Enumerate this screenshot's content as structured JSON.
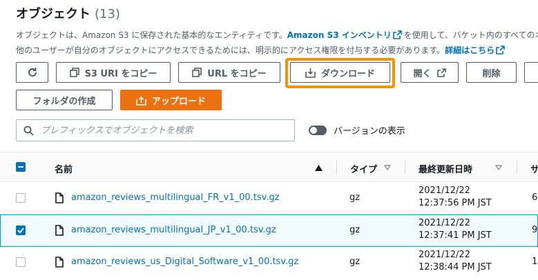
{
  "header": {
    "title": "オブジェクト",
    "count": "(13)",
    "desc1_pre": "オブジェクトは、Amazon S3 に保存された基本的なエンティティです。",
    "desc1_link": "Amazon S3 インベントリ",
    "desc1_post": "を使用して、バケット内のすべてのオ",
    "desc2_pre": "他のユーザーが自分のオブジェクトにアクセスできるためには、明示的にアクセス権限を付与する必要があります。",
    "desc2_link": "詳細はこちら"
  },
  "toolbar": {
    "refresh_icon": "refresh-icon",
    "copy_s3_uri": "S3 URI をコピー",
    "copy_url": "URL をコピー",
    "download": "ダウンロード",
    "open": "開く",
    "delete": "削除",
    "create_folder": "フォルダの作成",
    "upload": "アップロード"
  },
  "search": {
    "placeholder": "プレフィックスでオブジェクトを検索",
    "value": ""
  },
  "versions_toggle": {
    "label": "バージョンの表示",
    "on": false
  },
  "table": {
    "columns": {
      "name": "名前",
      "type": "タイプ",
      "modified": "最終更新日時",
      "size_cut": "サ"
    },
    "rows": [
      {
        "name": "amazon_reviews_multilingual_FR_v1_00.tsv.gz",
        "type": "gz",
        "date": "2021/12/22",
        "time": "12:37:56 PM JST",
        "size_cut": "6",
        "selected": false
      },
      {
        "name": "amazon_reviews_multilingual_JP_v1_00.tsv.gz",
        "type": "gz",
        "date": "2021/12/22",
        "time": "12:37:41 PM JST",
        "size_cut": "9",
        "selected": true
      },
      {
        "name": "amazon_reviews_us_Digital_Software_v1_00.tsv.gz",
        "type": "gz",
        "date": "2021/12/22",
        "time": "12:38:44 PM JST",
        "size_cut": "1",
        "selected": false
      }
    ]
  },
  "colors": {
    "accent": "#0073bb",
    "primary": "#ec7211",
    "highlight": "#f29400"
  }
}
